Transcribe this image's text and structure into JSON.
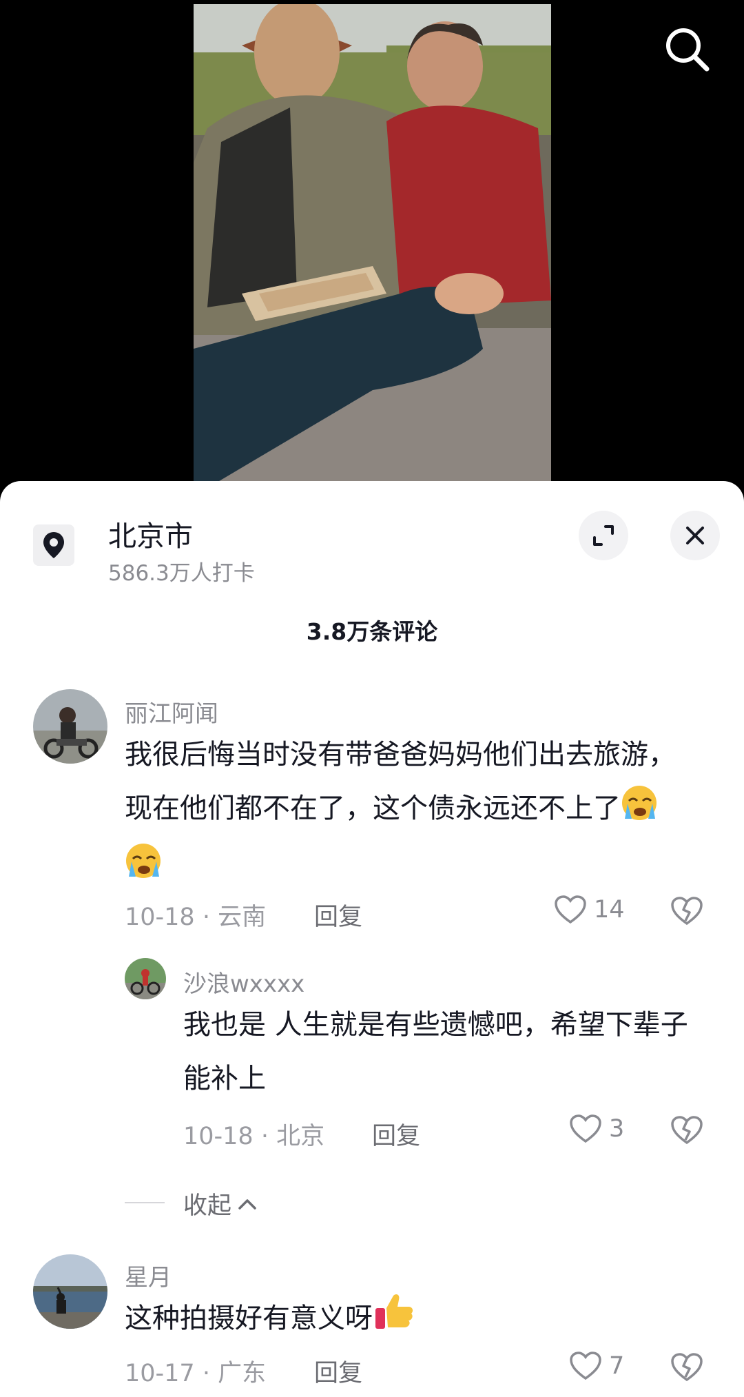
{
  "location": {
    "name": "北京市",
    "checkins": "586.3万人打卡"
  },
  "comments_header": "3.8万条评论",
  "comments": [
    {
      "user": "丽江阿闻",
      "text": "我很后悔当时没有带爸爸妈妈他们出去旅游，现在他们都不在了，这个债永远还不上了",
      "emoji": [
        "crying-face",
        "crying-face"
      ],
      "meta": "10-18 · 云南",
      "reply_label": "回复",
      "likes": "14"
    },
    {
      "user": "沙浪wxxxx",
      "text": "我也是 人生就是有些遗憾吧，希望下辈子能补上",
      "meta": "10-18 · 北京",
      "reply_label": "回复",
      "likes": "3"
    },
    {
      "user": "星月",
      "text": "这种拍摄好有意义呀",
      "emoji": [
        "thumbs-up"
      ],
      "meta": "10-17 · 广东",
      "reply_label": "回复",
      "likes": "7"
    }
  ],
  "collapse_label": "收起",
  "colors": {
    "primary_text": "#161823",
    "secondary_text": "#8a8b91",
    "sheet_bg": "#ffffff",
    "button_bg": "#f2f2f4"
  }
}
